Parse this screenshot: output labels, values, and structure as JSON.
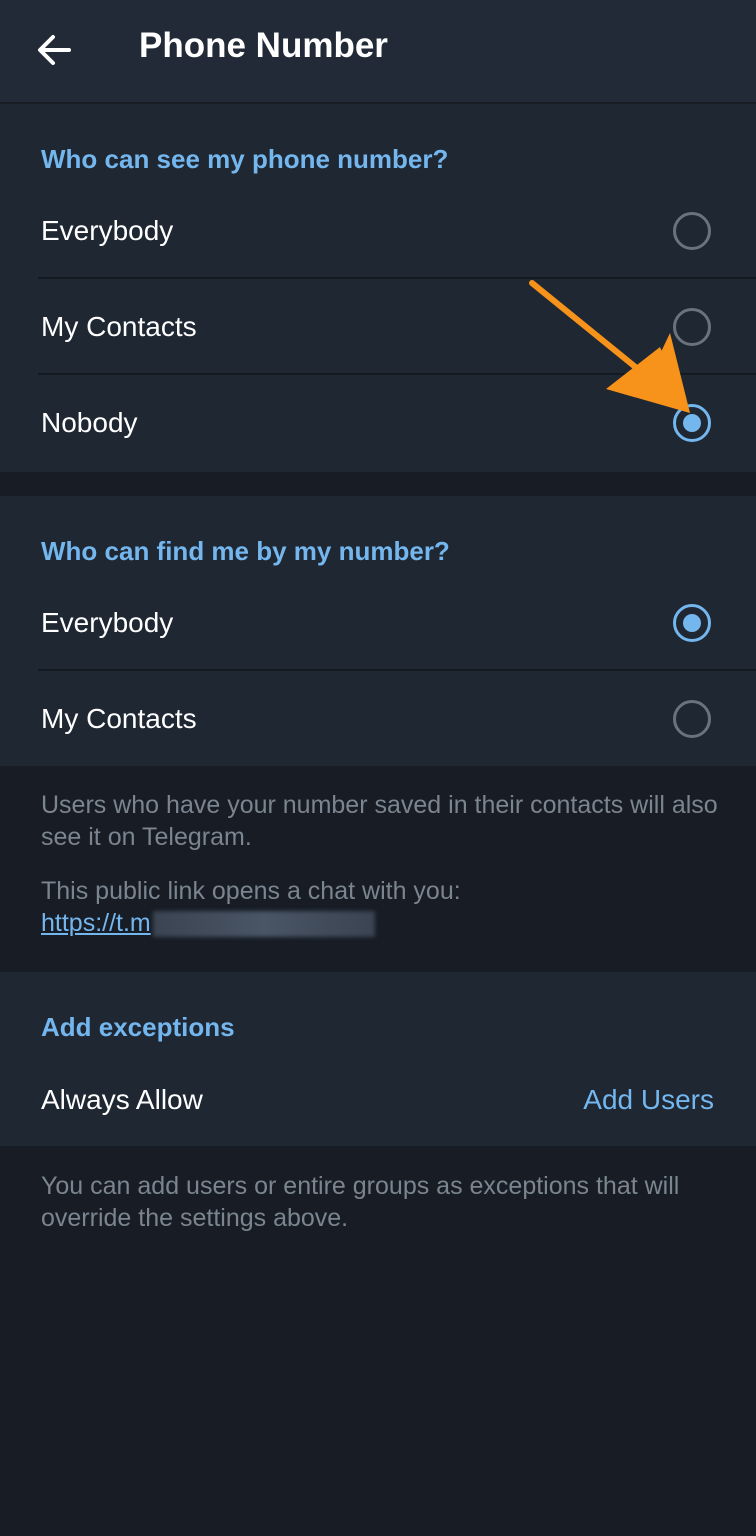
{
  "header": {
    "title": "Phone Number",
    "back_icon": "arrow-left-icon"
  },
  "see_section": {
    "title": "Who can see my phone number?",
    "options": [
      {
        "label": "Everybody",
        "selected": false
      },
      {
        "label": "My Contacts",
        "selected": false
      },
      {
        "label": "Nobody",
        "selected": true
      }
    ]
  },
  "find_section": {
    "title": "Who can find me by my number?",
    "options": [
      {
        "label": "Everybody",
        "selected": true
      },
      {
        "label": "My Contacts",
        "selected": false
      }
    ]
  },
  "info": {
    "text1": "Users who have your number saved in their contacts will also see it on Telegram.",
    "text2": "This public link opens a chat with you:",
    "link": "https://t.m"
  },
  "exceptions": {
    "title": "Add exceptions",
    "always_allow": "Always Allow",
    "add_users": "Add Users",
    "footer": "You can add users or entire groups as exceptions that will override the settings above."
  },
  "colors": {
    "accent": "#74b6ee",
    "background": "#171c25",
    "section_bg": "#1f2733",
    "annotation_arrow": "#f7931a"
  }
}
